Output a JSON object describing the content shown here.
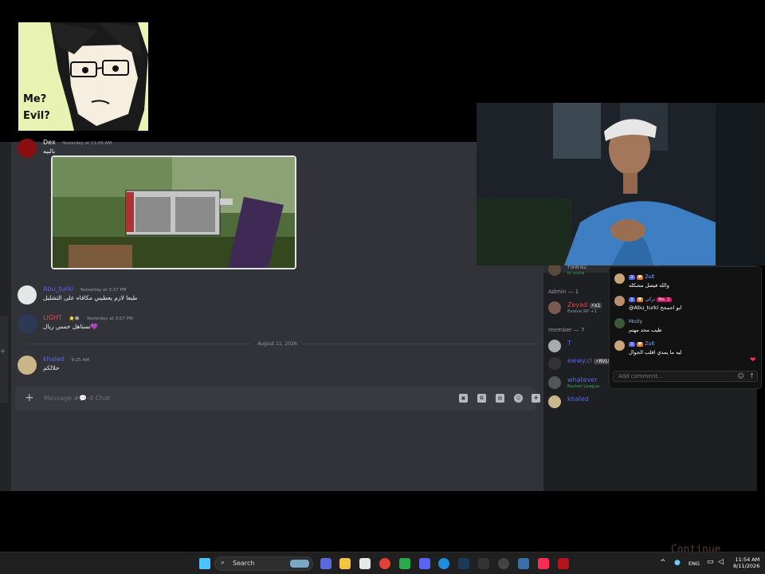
{
  "meme": {
    "caption_line1": "Me?",
    "caption_line2": "Evil?"
  },
  "chat": {
    "messages": [
      {
        "user": "Dex",
        "user_color": "#f2f3f5",
        "time": "Yesterday at 11:09 AM",
        "text": "بالبيه"
      },
      {
        "user": "Abu_turki",
        "user_color": "#5865f2",
        "time": "Yesterday at 3:37 PM",
        "text": "طبعا لازم يعطيني مكافاه على التشليل"
      },
      {
        "user": "LIGHT",
        "user_color": "#ed4245",
        "tag": "⭐🕸",
        "time": "Yesterday at 3:57 PM",
        "text": "💜تستاهل خمس ريال"
      },
      {
        "user": "khaled",
        "user_color": "#5865f2",
        "time": "9:25 AM",
        "text": "حلالكم"
      }
    ],
    "date_divider": "August 11, 2026",
    "composer": {
      "placeholder": "Message #💬-4 Chat"
    }
  },
  "members": {
    "top_user": {
      "name": "Fawaz",
      "status": "In voice"
    },
    "admin_header": "Admin — 1",
    "admin": {
      "name": "Zeyad",
      "badge": "⚡x1",
      "status": "Evolve RP +1"
    },
    "member_header": "member — 7",
    "list": [
      {
        "name": "T",
        "status": ""
      },
      {
        "name": "ewwy.cl",
        "badge": "⚡RVLS",
        "status": ""
      },
      {
        "name": "whatever",
        "status": "Rocket League"
      },
      {
        "name": "khaled",
        "status": ""
      }
    ]
  },
  "tiktok": {
    "comments": [
      {
        "user": "Zult",
        "level": "3",
        "text": "والله فيصل مشكله",
        "extra": ""
      },
      {
        "user": "تركي",
        "level": "3",
        "text": "@Abu_turki ابو احمحح",
        "extra": "No. 2"
      },
      {
        "user": "Mozly",
        "level": "",
        "text": "طيب محد مهتم",
        "extra": ""
      },
      {
        "user": "Zult",
        "level": "3",
        "text": "ليه ما يمدي اقلب الجوال",
        "extra": ""
      }
    ],
    "input_placeholder": "Add comment..."
  },
  "overlay_text": "Continue",
  "taskbar": {
    "search_placeholder": "Search",
    "language": "ENG",
    "time": "11:54 AM",
    "date": "8/11/2026"
  }
}
